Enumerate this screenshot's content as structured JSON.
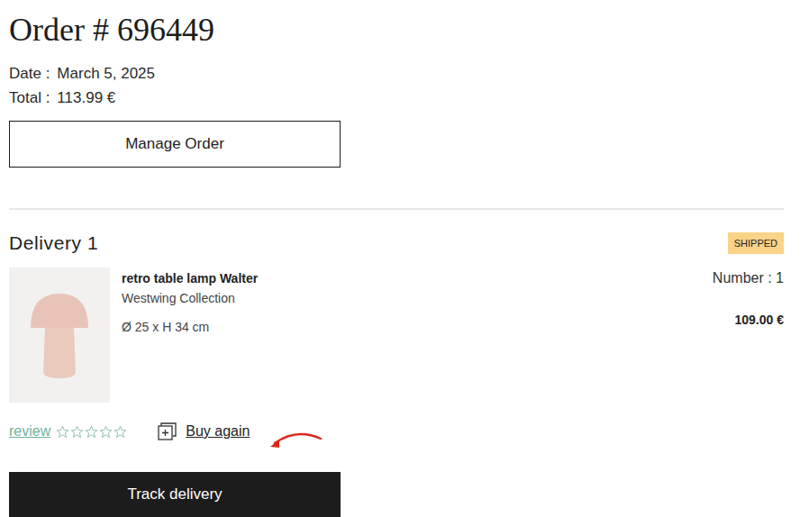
{
  "order": {
    "title": "Order # 696449",
    "fields": [
      {
        "label": "Date :",
        "value": "March 5, 2025"
      },
      {
        "label": "Total :",
        "value": "113.99 €"
      }
    ],
    "manage_button": "Manage Order"
  },
  "delivery": {
    "heading": "Delivery 1",
    "status": "SHIPPED",
    "items": [
      {
        "name": "retro table lamp Walter",
        "brand": "Westwing Collection",
        "dimensions": "Ø 25 x H 34 cm",
        "quantity": "Number : 1",
        "price": "109.00 €",
        "review": {
          "label": "review",
          "stars": 0
        },
        "buy_again": "Buy again"
      }
    ],
    "track_button": "Track delivery"
  }
}
